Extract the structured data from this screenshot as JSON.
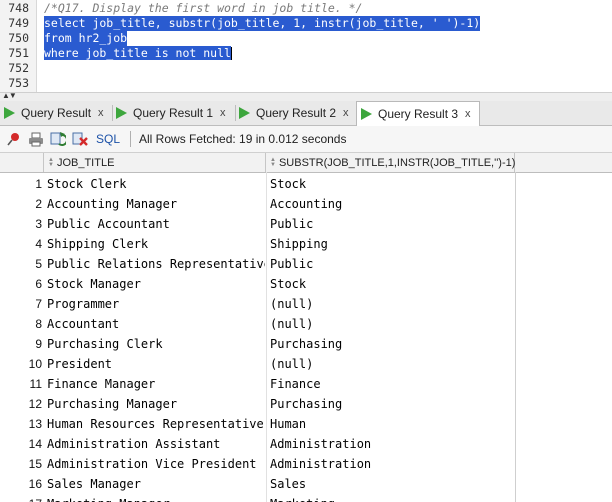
{
  "editor": {
    "lines": [
      {
        "num": "748",
        "text": "/*Q17. Display the first word in job title. */"
      },
      {
        "num": "749",
        "text": "select job_title, substr(job_title, 1, instr(job_title, ' ')-1)"
      },
      {
        "num": "750",
        "text": "from hr2_job"
      },
      {
        "num": "751",
        "text": "where job_title is not null"
      },
      {
        "num": "752",
        "text": ""
      },
      {
        "num": "753",
        "text": ""
      }
    ]
  },
  "tabs": [
    {
      "label": "Query Result",
      "close": "x"
    },
    {
      "label": "Query Result 1",
      "close": "x"
    },
    {
      "label": "Query Result 2",
      "close": "x"
    },
    {
      "label": "Query Result 3",
      "close": "x"
    }
  ],
  "toolbar": {
    "sql_label": "SQL",
    "status": "All Rows Fetched: 19 in 0.012 seconds"
  },
  "grid": {
    "columns": [
      "JOB_TITLE",
      "SUBSTR(JOB_TITLE,1,INSTR(JOB_TITLE,'')-1)"
    ],
    "rows": [
      {
        "n": "1",
        "c1": "Stock Clerk",
        "c2": "Stock"
      },
      {
        "n": "2",
        "c1": "Accounting Manager",
        "c2": "Accounting"
      },
      {
        "n": "3",
        "c1": "Public Accountant",
        "c2": "Public"
      },
      {
        "n": "4",
        "c1": "Shipping Clerk",
        "c2": "Shipping"
      },
      {
        "n": "5",
        "c1": "Public Relations Representative",
        "c2": "Public"
      },
      {
        "n": "6",
        "c1": "Stock Manager",
        "c2": "Stock"
      },
      {
        "n": "7",
        "c1": "Programmer",
        "c2": "(null)"
      },
      {
        "n": "8",
        "c1": "Accountant",
        "c2": "(null)"
      },
      {
        "n": "9",
        "c1": "Purchasing Clerk",
        "c2": "Purchasing"
      },
      {
        "n": "10",
        "c1": "President",
        "c2": "(null)"
      },
      {
        "n": "11",
        "c1": "Finance Manager",
        "c2": "Finance"
      },
      {
        "n": "12",
        "c1": "Purchasing Manager",
        "c2": "Purchasing"
      },
      {
        "n": "13",
        "c1": "Human Resources Representative",
        "c2": "Human"
      },
      {
        "n": "14",
        "c1": "Administration Assistant",
        "c2": "Administration"
      },
      {
        "n": "15",
        "c1": "Administration Vice President",
        "c2": "Administration"
      },
      {
        "n": "16",
        "c1": "Sales Manager",
        "c2": "Sales"
      },
      {
        "n": "17",
        "c1": "Marketing Manager",
        "c2": "Marketing"
      }
    ]
  },
  "colors": {
    "selection": "#2a5bd0",
    "run_icon": "#3da63d",
    "sql_link": "#1d52a8"
  },
  "icons": [
    "pin-icon",
    "print-icon",
    "refresh-icon",
    "cancel-icon",
    "run-icon",
    "splitter-arrows-icon"
  ]
}
